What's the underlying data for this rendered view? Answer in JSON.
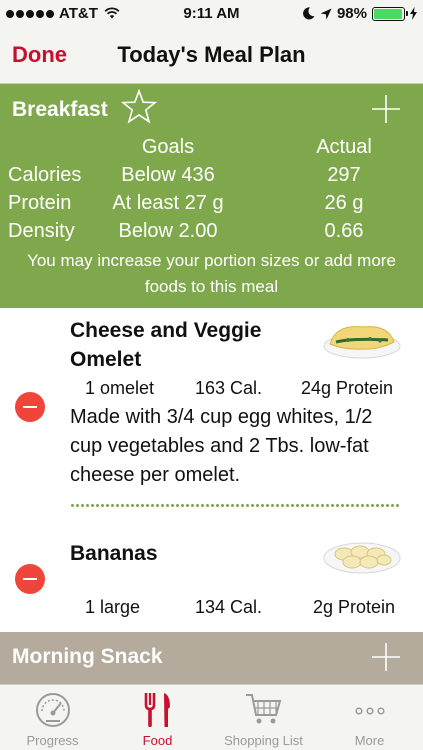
{
  "status": {
    "carrier": "AT&T",
    "time": "9:11 AM",
    "battery": "98%",
    "battery_level": 0.98
  },
  "nav": {
    "left_button": "Done",
    "title": "Today's Meal Plan"
  },
  "breakfast": {
    "title": "Breakfast",
    "header_goals": "Goals",
    "header_actual": "Actual",
    "rows": [
      {
        "label": "Calories",
        "goal": "Below 436",
        "actual": "297"
      },
      {
        "label": "Protein",
        "goal": "At least 27 g",
        "actual": "26 g"
      },
      {
        "label": "Density",
        "goal": "Below 2.00",
        "actual": "0.66"
      }
    ],
    "note": "You may increase your portion sizes or add more foods to this meal"
  },
  "foods": [
    {
      "name": "Cheese and Veggie Omelet",
      "serving": "1 omelet",
      "calories": "163 Cal.",
      "protein": "24g Protein",
      "description": "Made with 3/4 cup egg whites, 1/2 cup vegetables and 2 Tbs. low-fat cheese per omelet."
    },
    {
      "name": "Bananas",
      "serving": "1 large",
      "calories": "134 Cal.",
      "protein": "2g Protein"
    }
  ],
  "snack": {
    "title": "Morning Snack"
  },
  "tabs": [
    {
      "label": "Progress",
      "icon": "gauge-icon"
    },
    {
      "label": "Food",
      "icon": "fork-knife-icon"
    },
    {
      "label": "Shopping List",
      "icon": "cart-icon"
    },
    {
      "label": "More",
      "icon": "more-dots-icon"
    }
  ],
  "colors": {
    "accent": "#c8102e",
    "breakfast_bg": "#7fa84d",
    "snack_bg": "#b5ab9d",
    "remove": "#f0453a"
  }
}
